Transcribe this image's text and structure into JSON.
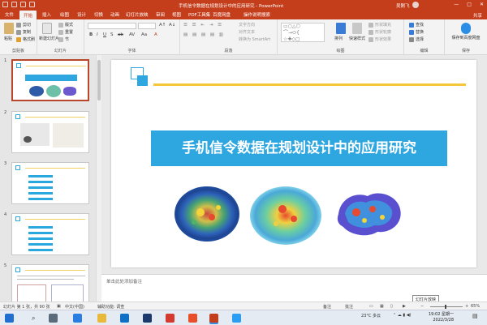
{
  "window": {
    "title": "手机信令数据在规划设计中的应用研究 - PowerPoint",
    "user": "吴刚飞",
    "controls": [
      "—",
      "□",
      "✕"
    ]
  },
  "tabs": [
    {
      "label": "文件",
      "active": false
    },
    {
      "label": "开始",
      "active": true
    },
    {
      "label": "插入",
      "active": false
    },
    {
      "label": "绘图",
      "active": false
    },
    {
      "label": "设计",
      "active": false
    },
    {
      "label": "切换",
      "active": false
    },
    {
      "label": "动画",
      "active": false
    },
    {
      "label": "幻灯片放映",
      "active": false
    },
    {
      "label": "审阅",
      "active": false
    },
    {
      "label": "视图",
      "active": false
    },
    {
      "label": "PDF工具集",
      "active": false
    },
    {
      "label": "百度网盘",
      "active": false
    },
    {
      "label": "操作说明搜索",
      "active": false
    }
  ],
  "share_label": "共享",
  "ribbon": {
    "clipboard": {
      "label": "剪贴板",
      "paste": "粘贴",
      "cut": "剪切",
      "copy": "复制",
      "format_painter": "格式刷"
    },
    "slides": {
      "label": "幻灯片",
      "new_slide": "新建幻灯片",
      "layout": "版式",
      "reset": "重置",
      "section": "节"
    },
    "font": {
      "label": "字体"
    },
    "paragraph": {
      "label": "段落",
      "text_direction": "文字方向",
      "align_text": "对齐文本",
      "smartart": "转换为 SmartArt"
    },
    "drawing": {
      "label": "绘图",
      "arrange": "排列",
      "quick_styles": "快速样式",
      "shape_fill": "形状填充",
      "shape_outline": "形状轮廓",
      "shape_effects": "形状效果"
    },
    "editing": {
      "label": "编辑",
      "find": "查找",
      "replace": "替换",
      "select": "选择"
    },
    "save": {
      "label": "保存",
      "save_to_baidu": "保存到百度网盘"
    }
  },
  "slides": [
    {
      "number": "1"
    },
    {
      "number": "2"
    },
    {
      "number": "3"
    },
    {
      "number": "4"
    },
    {
      "number": "5"
    }
  ],
  "main_slide": {
    "title": "手机信令数据在规划设计中的应用研究"
  },
  "notes": {
    "placeholder": "单击此处添加备注",
    "tooltip": "幻灯片放映"
  },
  "status": {
    "slide_info": "幻灯片 第 1 张，共 90 张",
    "language": "中文(中国)",
    "accessibility": "辅助功能: 调查",
    "notes_btn": "备注",
    "comments_btn": "批注",
    "zoom": "65%"
  },
  "taskbar": {
    "weather": "23°C 多云",
    "time": "19:02 星期一",
    "date": "2022/3/28"
  },
  "colors": {
    "brand": "#c43e1c",
    "accent_blue": "#2ea7e0",
    "accent_yellow": "#f2c83a"
  }
}
